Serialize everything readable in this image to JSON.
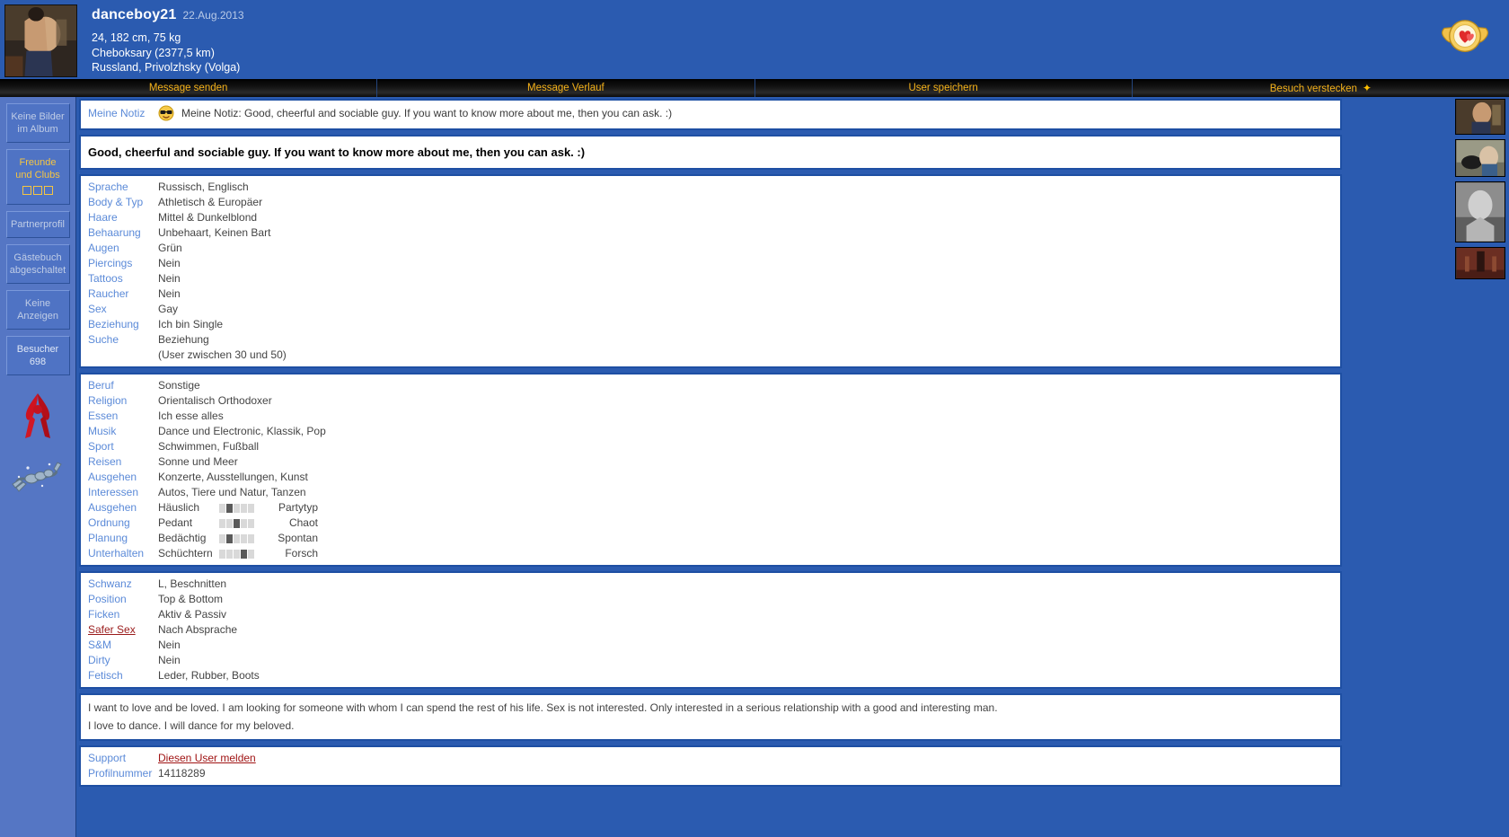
{
  "header": {
    "username": "danceboy21",
    "date": "22.Aug.2013",
    "stats": "24, 182 cm, 75 kg",
    "city": "Cheboksary (2377,5 km)",
    "region": "Russland, Privolzhsky (Volga)",
    "badge_icon": "heart-badge-icon",
    "avatar_icon": "profile-avatar"
  },
  "nav": {
    "items": [
      {
        "label": "Message senden"
      },
      {
        "label": "Message Verlauf"
      },
      {
        "label": "User speichern"
      },
      {
        "label": "Besuch verstecken",
        "star": "✦"
      }
    ]
  },
  "sidebar": {
    "no_pictures": "Keine Bilder\nim Album",
    "friends": "Freunde\nund Clubs",
    "partner": "Partnerprofil",
    "guestbook": "Gästebuch\nabgeschaltet",
    "no_ads": "Keine\nAnzeigen",
    "visitors_label": "Besucher",
    "visitors_count": "698",
    "ribbon_icon": "aids-ribbon-icon",
    "zodiac_icon": "scorpio-zodiac-icon"
  },
  "thumbs": {
    "items": [
      {
        "name": "thumbnail-1"
      },
      {
        "name": "thumbnail-2"
      },
      {
        "name": "thumbnail-3"
      },
      {
        "name": "thumbnail-4"
      }
    ]
  },
  "note": {
    "label": "Meine Notiz",
    "emoji_icon": "cool-smiley-icon",
    "text": "Meine Notiz: Good, cheerful and sociable guy. If you want to know more about me, then you can ask. :)"
  },
  "headline": "Good, cheerful and sociable guy. If you want to know more about me, then you can ask. :)",
  "section_basic": [
    {
      "label": "Sprache",
      "value": "Russisch, Englisch"
    },
    {
      "label": "Body & Typ",
      "value": "Athletisch & Europäer"
    },
    {
      "label": "Haare",
      "value": "Mittel & Dunkelblond"
    },
    {
      "label": "Behaarung",
      "value": "Unbehaart, Keinen Bart"
    },
    {
      "label": "Augen",
      "value": "Grün"
    },
    {
      "label": "Piercings",
      "value": "Nein"
    },
    {
      "label": "Tattoos",
      "value": "Nein"
    },
    {
      "label": "Raucher",
      "value": "Nein"
    },
    {
      "label": "Sex",
      "value": "Gay"
    },
    {
      "label": "Beziehung",
      "value": "Ich bin Single"
    },
    {
      "label": "Suche",
      "value": "Beziehung"
    },
    {
      "label": "",
      "value": "(User zwischen 30 und 50)"
    }
  ],
  "section_interests": [
    {
      "label": "Beruf",
      "value": "Sonstige"
    },
    {
      "label": "Religion",
      "value": "Orientalisch Orthodoxer"
    },
    {
      "label": "Essen",
      "value": "Ich esse alles"
    },
    {
      "label": "Musik",
      "value": "Dance und Electronic, Klassik, Pop"
    },
    {
      "label": "Sport",
      "value": "Schwimmen, Fußball"
    },
    {
      "label": "Reisen",
      "value": "Sonne und Meer"
    },
    {
      "label": "Ausgehen",
      "value": "Konzerte, Ausstellungen, Kunst"
    },
    {
      "label": "Interessen",
      "value": "Autos, Tiere und Natur, Tanzen"
    }
  ],
  "sliders": [
    {
      "label": "Ausgehen",
      "left": "Häuslich",
      "right": "Partytyp",
      "value": 2,
      "max": 5
    },
    {
      "label": "Ordnung",
      "left": "Pedant",
      "right": "Chaot",
      "value": 3,
      "max": 5
    },
    {
      "label": "Planung",
      "left": "Bedächtig",
      "right": "Spontan",
      "value": 2,
      "max": 5
    },
    {
      "label": "Unterhalten",
      "left": "Schüchtern",
      "right": "Forsch",
      "value": 4,
      "max": 5
    }
  ],
  "section_sex": [
    {
      "label": "Schwanz",
      "value": "L, Beschnitten",
      "warn": false
    },
    {
      "label": "Position",
      "value": "Top & Bottom",
      "warn": false
    },
    {
      "label": "Ficken",
      "value": "Aktiv & Passiv",
      "warn": false
    },
    {
      "label": "Safer Sex",
      "value": "Nach Absprache",
      "warn": true
    },
    {
      "label": "S&M",
      "value": "Nein",
      "warn": false
    },
    {
      "label": "Dirty",
      "value": "Nein",
      "warn": false
    },
    {
      "label": "Fetisch",
      "value": "Leder, Rubber, Boots",
      "warn": false
    }
  ],
  "about": {
    "line1": "I want to love and be loved. I am looking for someone with whom I can spend the rest of his life. Sex is not interested. Only interested in a serious relationship with a good and interesting man.",
    "line2": "I love to dance. I will dance for my beloved."
  },
  "support": {
    "label": "Support",
    "link": "Diesen User melden",
    "profile_label": "Profilnummer",
    "profile_number": "14118289"
  },
  "colors": {
    "page_bg": "#2b5bb0",
    "panel_border": "#1e4fa3",
    "label_blue": "#5b8ad8",
    "nav_yellow": "#f5b21a",
    "link_red": "#a01414"
  }
}
